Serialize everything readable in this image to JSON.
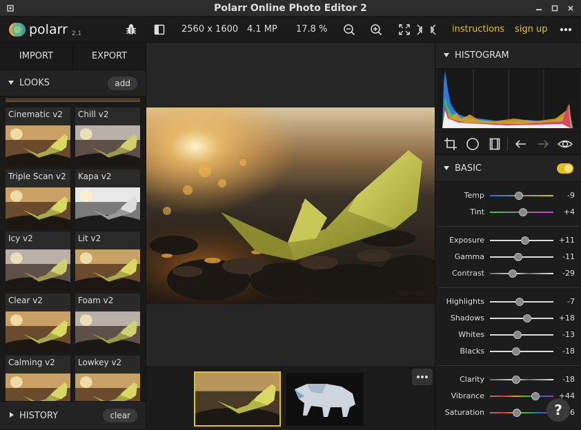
{
  "window": {
    "title": "Polarr Online Photo Editor 2"
  },
  "toolbar": {
    "logo_text": "polarr",
    "version": "2.1",
    "dimensions": "2560 x 1600",
    "megapixels": "4.1 MP",
    "zoom": "17.8 %",
    "instructions_label": "instructions",
    "signup_label": "sign up"
  },
  "left_panel": {
    "import_label": "IMPORT",
    "export_label": "EXPORT",
    "looks_title": "LOOKS",
    "add_label": "add",
    "looks": [
      {
        "name": "Cinematic v2",
        "style": "warm"
      },
      {
        "name": "Chill v2",
        "style": "cool"
      },
      {
        "name": "Triple Scan v2",
        "style": "warm"
      },
      {
        "name": "Kapa v2",
        "style": "mono"
      },
      {
        "name": "Icy v2",
        "style": "cool"
      },
      {
        "name": "Lit v2",
        "style": "warm"
      },
      {
        "name": "Clear v2",
        "style": "warm"
      },
      {
        "name": "Foam v2",
        "style": "cool"
      },
      {
        "name": "Calming v2",
        "style": "warm"
      },
      {
        "name": "Lowkey v2",
        "style": "warm"
      }
    ],
    "history_title": "HISTORY",
    "clear_label": "clear"
  },
  "right_panel": {
    "histogram_title": "HISTOGRAM",
    "basic_title": "BASIC",
    "sliders": [
      [
        {
          "name": "Temp",
          "value": "-9",
          "level": -9,
          "track": "temp"
        },
        {
          "name": "Tint",
          "value": "+4",
          "level": 4,
          "track": "tint"
        }
      ],
      [
        {
          "name": "Exposure",
          "value": "+11",
          "level": 11,
          "track": "plain"
        },
        {
          "name": "Gamma",
          "value": "-11",
          "level": -11,
          "track": "plain"
        },
        {
          "name": "Contrast",
          "value": "-29",
          "level": -29,
          "track": "contrast"
        }
      ],
      [
        {
          "name": "Highlights",
          "value": "-7",
          "level": -7,
          "track": "plain"
        },
        {
          "name": "Shadows",
          "value": "+18",
          "level": 18,
          "track": "plain"
        },
        {
          "name": "Whites",
          "value": "-13",
          "level": -13,
          "track": "plain"
        },
        {
          "name": "Blacks",
          "value": "-18",
          "level": -18,
          "track": "plain"
        }
      ],
      [
        {
          "name": "Clarity",
          "value": "-18",
          "level": -18,
          "track": "contrast"
        },
        {
          "name": "Vibrance",
          "value": "+44",
          "level": 44,
          "track": "rainbow"
        },
        {
          "name": "Saturation",
          "value": "-16",
          "level": -16,
          "track": "rainbow"
        }
      ]
    ]
  },
  "colors": {
    "accent": "#e4c11a",
    "panel": "#1c1c1c",
    "canvas": "#262626"
  }
}
